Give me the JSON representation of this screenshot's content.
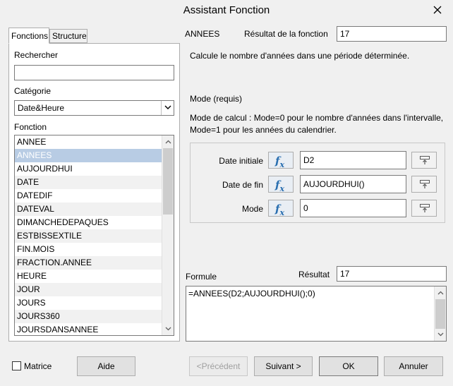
{
  "window": {
    "title": "Assistant Fonction"
  },
  "tabs": [
    {
      "label": "Fonctions",
      "active": true
    },
    {
      "label": "Structure",
      "active": false
    }
  ],
  "left_panel": {
    "search_label": "Rechercher",
    "search_value": "",
    "category_label": "Catégorie",
    "category_value": "Date&Heure",
    "function_label": "Fonction",
    "functions": [
      "ANNEE",
      "ANNEES",
      "AUJOURDHUI",
      "DATE",
      "DATEDIF",
      "DATEVAL",
      "DIMANCHEDEPAQUES",
      "ESTBISSEXTILE",
      "FIN.MOIS",
      "FRACTION.ANNEE",
      "HEURE",
      "JOUR",
      "JOURS",
      "JOURS360",
      "JOURSDANSANNEE"
    ],
    "selected_function": "ANNEES"
  },
  "right_panel": {
    "function_name": "ANNEES",
    "result_label": "Résultat de la fonction",
    "result_value": "17",
    "description": "Calcule le nombre d'années dans une période déterminée.",
    "param_title": "Mode (requis)",
    "param_description_1": "Mode de calcul : Mode=0 pour le nombre d'années dans l'intervalle,",
    "param_description_2": "Mode=1 pour les années du calendrier.",
    "arguments": [
      {
        "label": "Date initiale",
        "value": "D2"
      },
      {
        "label": "Date de fin",
        "value": "AUJOURDHUI()"
      },
      {
        "label": "Mode",
        "value": "0"
      }
    ],
    "formula_label": "Formule",
    "formula_result_label": "Résultat",
    "formula_result_value": "17",
    "formula": "=ANNEES(D2;AUJOURDHUI();0)"
  },
  "footer": {
    "matrix_label": "Matrice",
    "matrix_checked": false,
    "help_label": "Aide",
    "prev_label": "<Précédent",
    "next_label": "Suivant >",
    "ok_label": "OK",
    "cancel_label": "Annuler"
  },
  "icons": {
    "close": "close-icon",
    "function": "fx-icon",
    "pick": "shrink-select-icon"
  },
  "colors": {
    "selected_row": "#b8cce4",
    "fx_blue": "#2a6fb0"
  }
}
